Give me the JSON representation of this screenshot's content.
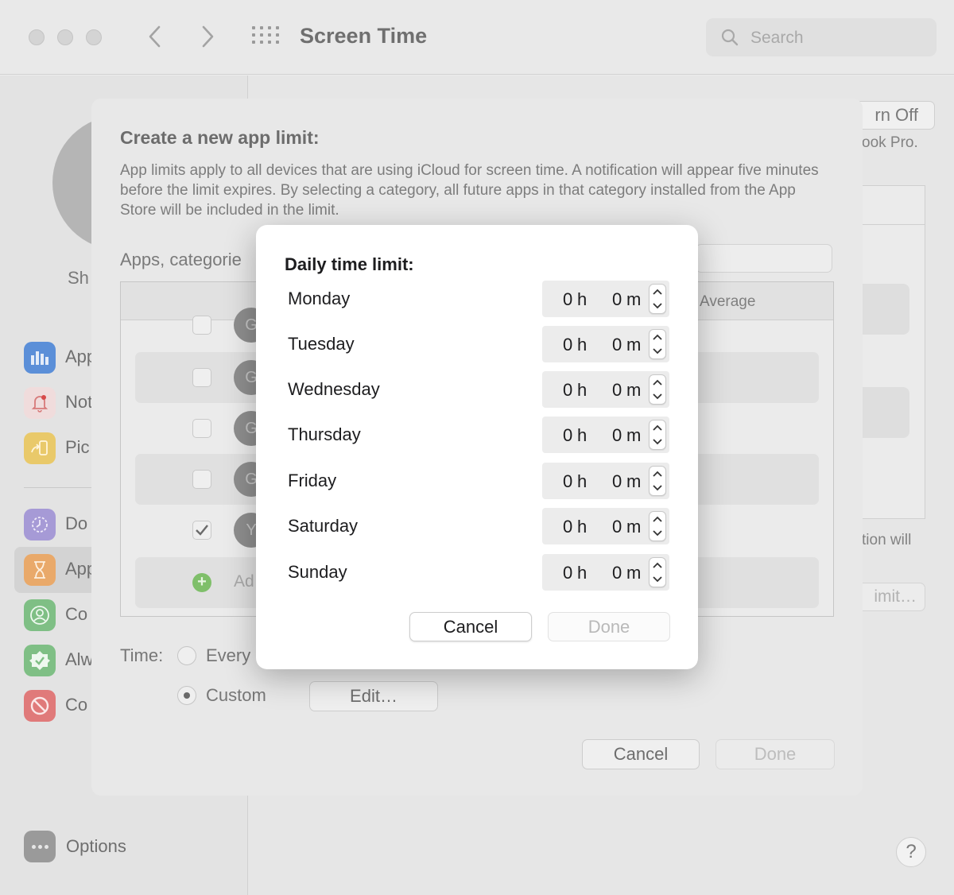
{
  "window": {
    "title": "Screen Time",
    "search_placeholder": "Search"
  },
  "sidebar": {
    "user_name": "Sh",
    "items": [
      {
        "label": "App",
        "icon": "bar-chart-icon",
        "color": "#5b8fd8"
      },
      {
        "label": "Not",
        "icon": "bell-icon",
        "color": "#e6a8a8"
      },
      {
        "label": "Pic",
        "icon": "pickup-icon",
        "color": "#e9c96a"
      },
      {
        "label": "Do",
        "icon": "downtime-icon",
        "color": "#a69ad6"
      },
      {
        "label": "App",
        "icon": "hourglass-icon",
        "color": "#e9a96a",
        "selected": true
      },
      {
        "label": "Co",
        "icon": "contact-icon",
        "color": "#7fbf85"
      },
      {
        "label": "Alw",
        "icon": "checkmark-shield-icon",
        "color": "#7fbf85"
      },
      {
        "label": "Co",
        "icon": "no-sign-icon",
        "color": "#e07a7a"
      }
    ],
    "options_label": "Options"
  },
  "main": {
    "turn_off_label": "rn Off",
    "device_text": "ook Pro.",
    "notification_text": "tion will",
    "limit_button_label": "imit…",
    "help_label": "?"
  },
  "sheet": {
    "title": "Create a new app limit:",
    "description": "App limits apply to all devices that are using iCloud for screen time. A notification will appear five minutes before the limit expires. By selecting a category, all future apps in that category installed from the App Store will be included in the limit.",
    "apps_label": "Apps, categorie",
    "table_header": "Average",
    "rows": [
      {
        "avatar": "G",
        "checked": false
      },
      {
        "avatar": "G",
        "checked": false
      },
      {
        "avatar": "G",
        "checked": false
      },
      {
        "avatar": "G",
        "checked": false
      },
      {
        "avatar": "Y",
        "checked": true
      }
    ],
    "add_label": "Ad",
    "time_label": "Time:",
    "option_every": "Every",
    "option_custom": "Custom",
    "selected_option": "Custom",
    "edit_label": "Edit…",
    "cancel_label": "Cancel",
    "done_label": "Done"
  },
  "dialog": {
    "title": "Daily time limit:",
    "days": [
      {
        "day": "Monday",
        "hours": "0",
        "minutes": "0"
      },
      {
        "day": "Tuesday",
        "hours": "0",
        "minutes": "0"
      },
      {
        "day": "Wednesday",
        "hours": "0",
        "minutes": "0"
      },
      {
        "day": "Thursday",
        "hours": "0",
        "minutes": "0"
      },
      {
        "day": "Friday",
        "hours": "0",
        "minutes": "0"
      },
      {
        "day": "Saturday",
        "hours": "0",
        "minutes": "0"
      },
      {
        "day": "Sunday",
        "hours": "0",
        "minutes": "0"
      }
    ],
    "hour_unit": "h",
    "minute_unit": "m",
    "cancel_label": "Cancel",
    "done_label": "Done"
  }
}
